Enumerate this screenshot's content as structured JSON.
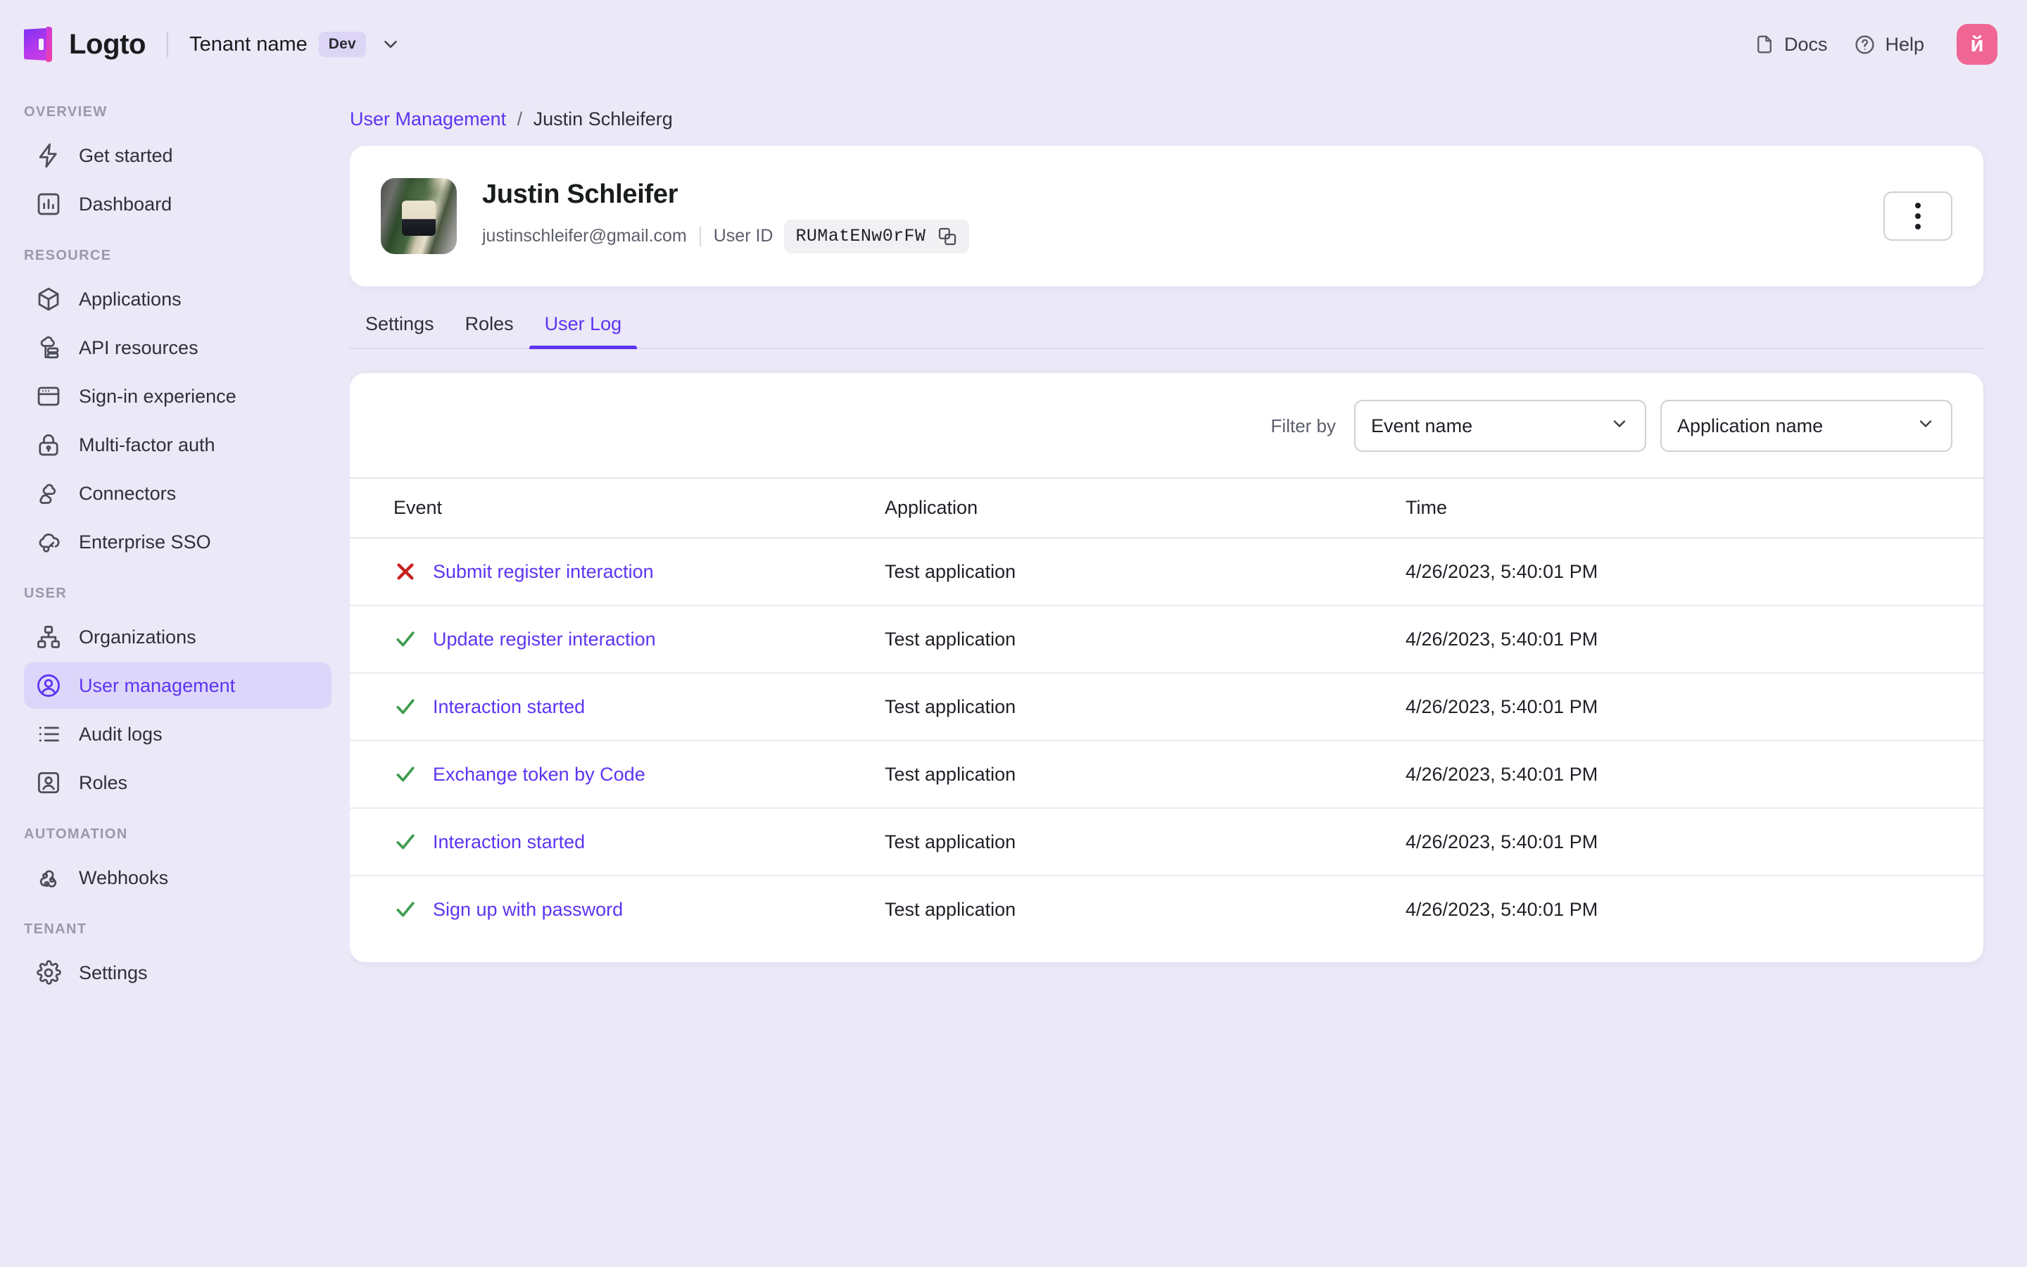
{
  "topbar": {
    "product_name": "Logto",
    "tenant_name": "Tenant name",
    "tenant_badge": "Dev",
    "docs_label": "Docs",
    "help_label": "Help",
    "avatar_initial": "й",
    "avatar_color": "#ef6694"
  },
  "sidebar": {
    "sections": [
      {
        "title": "Overview",
        "items": [
          {
            "label": "Get started",
            "icon": "bolt-icon",
            "active": false
          },
          {
            "label": "Dashboard",
            "icon": "chart-icon",
            "active": false
          }
        ]
      },
      {
        "title": "Resource",
        "items": [
          {
            "label": "Applications",
            "icon": "cube-icon",
            "active": false
          },
          {
            "label": "API resources",
            "icon": "api-icon",
            "active": false
          },
          {
            "label": "Sign-in experience",
            "icon": "window-icon",
            "active": false
          },
          {
            "label": "Multi-factor auth",
            "icon": "lock-icon",
            "active": false
          },
          {
            "label": "Connectors",
            "icon": "connectors-icon",
            "active": false
          },
          {
            "label": "Enterprise SSO",
            "icon": "cloud-key-icon",
            "active": false
          }
        ]
      },
      {
        "title": "User",
        "items": [
          {
            "label": "Organizations",
            "icon": "org-chart-icon",
            "active": false
          },
          {
            "label": "User management",
            "icon": "user-circle-icon",
            "active": true
          },
          {
            "label": "Audit logs",
            "icon": "list-icon",
            "active": false
          },
          {
            "label": "Roles",
            "icon": "user-badge-icon",
            "active": false
          }
        ]
      },
      {
        "title": "Automation",
        "items": [
          {
            "label": "Webhooks",
            "icon": "webhook-icon",
            "active": false
          }
        ]
      },
      {
        "title": "Tenant",
        "items": [
          {
            "label": "Settings",
            "icon": "gear-icon",
            "active": false
          }
        ]
      }
    ]
  },
  "breadcrumb": {
    "parent": "User Management",
    "separator": "/",
    "current": "Justin Schleiferg"
  },
  "profile": {
    "name": "Justin Schleifer",
    "email": "justinschleifer@gmail.com",
    "user_id_label": "User ID",
    "user_id": "RUMatENw0rFW"
  },
  "tabs": [
    {
      "label": "Settings",
      "active": false
    },
    {
      "label": "Roles",
      "active": false
    },
    {
      "label": "User Log",
      "active": true
    }
  ],
  "filters": {
    "label": "Filter by",
    "event_name": "Event name",
    "application_name": "Application name"
  },
  "table": {
    "columns": [
      "Event",
      "Application",
      "Time"
    ],
    "rows": [
      {
        "status": "error",
        "event": "Submit register interaction",
        "application": "Test application",
        "time": "4/26/2023, 5:40:01 PM"
      },
      {
        "status": "success",
        "event": "Update register interaction",
        "application": "Test application",
        "time": "4/26/2023, 5:40:01 PM"
      },
      {
        "status": "success",
        "event": "Interaction started",
        "application": "Test application",
        "time": "4/26/2023, 5:40:01 PM"
      },
      {
        "status": "success",
        "event": "Exchange token by Code",
        "application": "Test application",
        "time": "4/26/2023, 5:40:01 PM"
      },
      {
        "status": "success",
        "event": "Interaction started",
        "application": "Test application",
        "time": "4/26/2023, 5:40:01 PM"
      },
      {
        "status": "success",
        "event": "Sign up with password",
        "application": "Test application",
        "time": "4/26/2023, 5:40:01 PM"
      }
    ]
  },
  "colors": {
    "accent": "#5d34f2",
    "success": "#3e9c4f",
    "error": "#c5221f",
    "page_bg": "#ebe8f7"
  }
}
